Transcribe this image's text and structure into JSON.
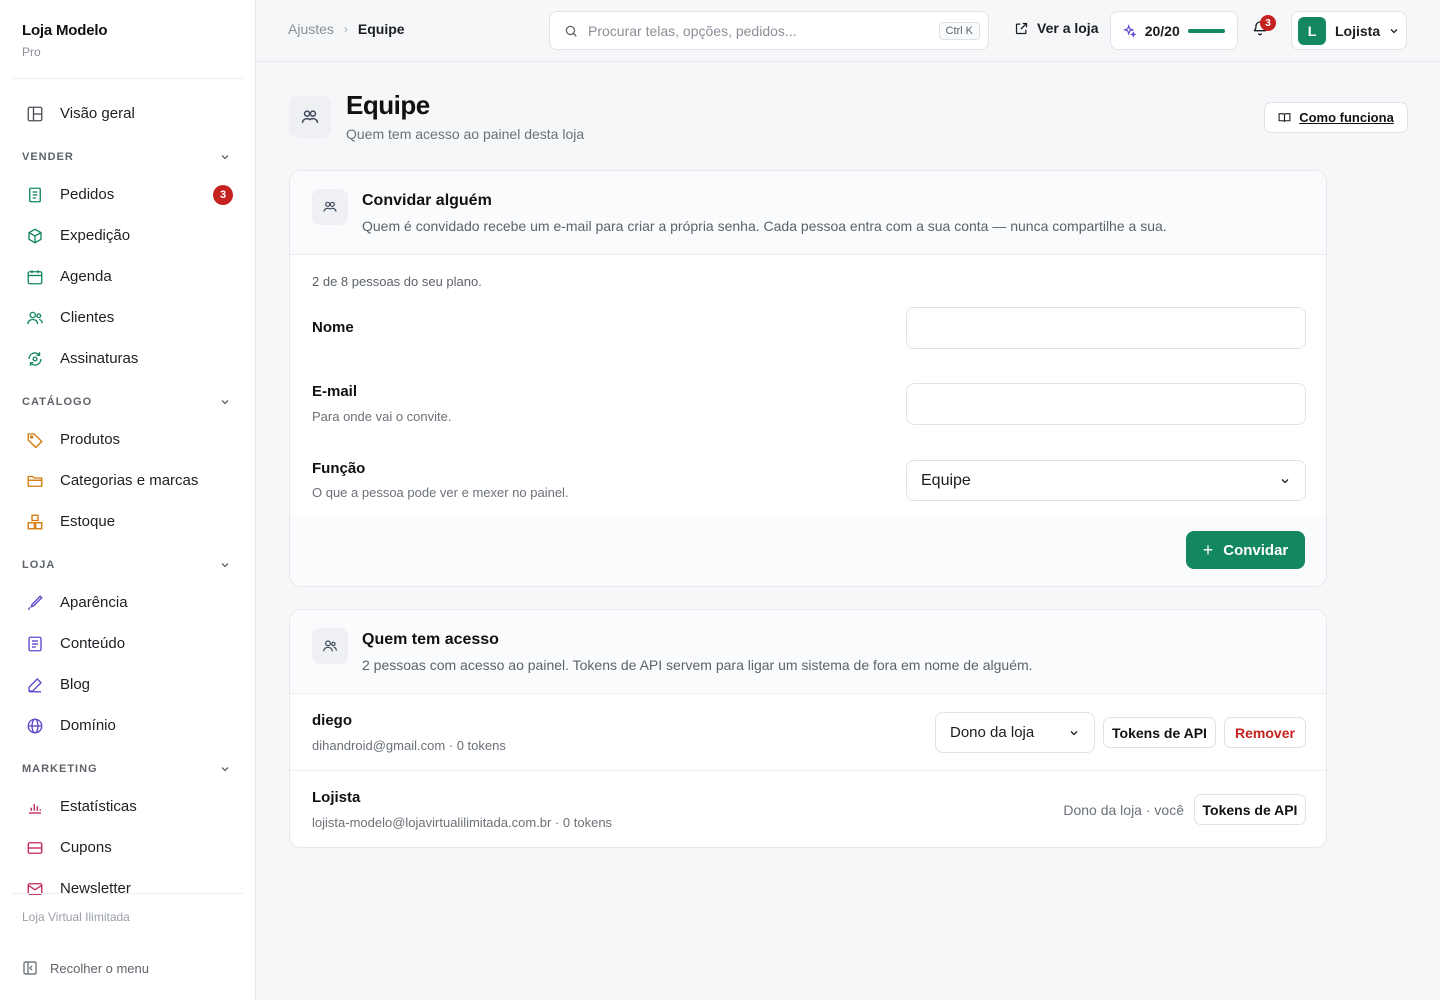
{
  "brand": {
    "name": "Loja Modelo",
    "plan": "Pro"
  },
  "nav": {
    "overview": "Visão geral",
    "sections": [
      {
        "title": "VENDER",
        "items": [
          {
            "label": "Pedidos",
            "badge": "3"
          },
          {
            "label": "Expedição"
          },
          {
            "label": "Agenda"
          },
          {
            "label": "Clientes"
          },
          {
            "label": "Assinaturas"
          }
        ]
      },
      {
        "title": "CATÁLOGO",
        "items": [
          {
            "label": "Produtos"
          },
          {
            "label": "Categorias e marcas"
          },
          {
            "label": "Estoque"
          }
        ]
      },
      {
        "title": "LOJA",
        "items": [
          {
            "label": "Aparência"
          },
          {
            "label": "Conteúdo"
          },
          {
            "label": "Blog"
          },
          {
            "label": "Domínio"
          }
        ]
      },
      {
        "title": "MARKETING",
        "items": [
          {
            "label": "Estatísticas"
          },
          {
            "label": "Cupons"
          },
          {
            "label": "Newsletter"
          }
        ]
      }
    ],
    "footer_label": "Loja Virtual Ilimitada",
    "collapse_label": "Recolher o menu"
  },
  "topbar": {
    "breadcrumb": [
      "Ajustes",
      "Equipe"
    ],
    "search_placeholder": "Procurar telas, opções, pedidos...",
    "search_shortcut": "Ctrl K",
    "store_link": "Ver a loja",
    "quota": "20/20",
    "quota_fraction": 1.0,
    "notifications": "3",
    "user_initial": "L",
    "user_name": "Lojista"
  },
  "page": {
    "title": "Equipe",
    "subtitle": "Quem tem acesso ao painel desta loja",
    "help_button": "Como funciona"
  },
  "invite": {
    "title": "Convidar alguém",
    "description": "Quem é convidado recebe um e-mail para criar a própria senha. Cada pessoa entra com a sua conta — nunca compartilhe a sua.",
    "plan_note": "2 de 8 pessoas do seu plano.",
    "name_label": "Nome",
    "name_value": "",
    "email_label": "E-mail",
    "email_hint": "Para onde vai o convite.",
    "email_value": "",
    "role_label": "Função",
    "role_hint": "O que a pessoa pode ver e mexer no painel.",
    "role_value": "Equipe",
    "submit_label": "Convidar"
  },
  "access": {
    "title": "Quem tem acesso",
    "description": "2 pessoas com acesso ao painel. Tokens de API servem para ligar um sistema de fora em nome de alguém.",
    "members": [
      {
        "name": "diego",
        "email": "dihandroid@gmail.com",
        "tokens": "0 tokens",
        "role": "Dono da loja",
        "tokens_btn": "Tokens de API",
        "remove_btn": "Remover"
      },
      {
        "name": "Lojista",
        "email": "lojista-modelo@lojavirtualilimitada.com.br",
        "tokens": "0 tokens",
        "role_static": "Dono da loja · você",
        "tokens_btn": "Tokens de API"
      }
    ]
  },
  "colors": {
    "accent": "#13875f",
    "danger": "#c5221f"
  }
}
